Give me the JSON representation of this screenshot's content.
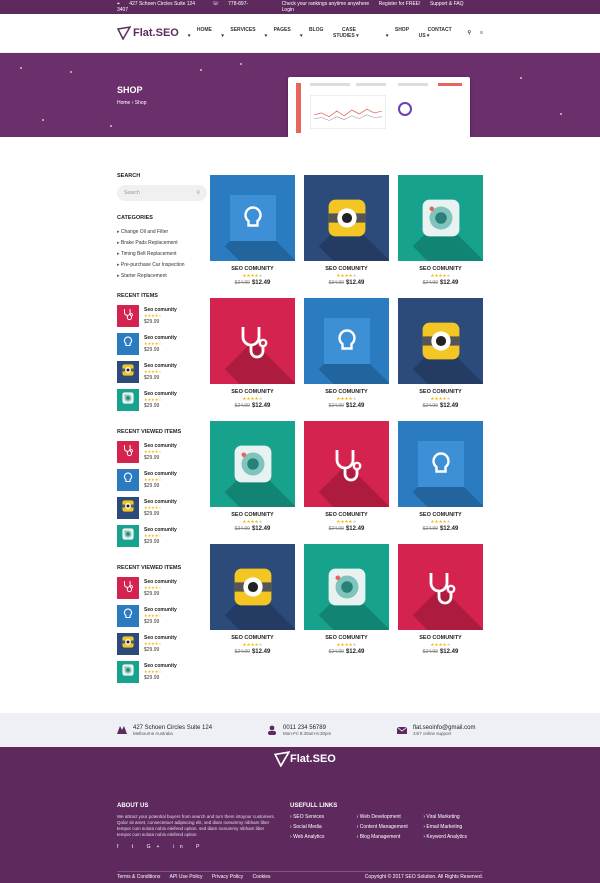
{
  "topbar": {
    "address": "427 Schoen Circles Suite 124",
    "phone": "778-897-3407",
    "links": [
      "Check your rankings anytime anywhere",
      "Register for FREE!",
      "Support & FAQ",
      "Login"
    ]
  },
  "nav": {
    "logo": "Flat.SEO",
    "menu": [
      "HOME",
      "SERVICES",
      "PAGES",
      "BLOG",
      "CASE STUDIES",
      "SHOP",
      "CONTACT US"
    ]
  },
  "hero": {
    "title": "SHOP",
    "breadcrumb": [
      "Home",
      "Shop"
    ]
  },
  "sidebar": {
    "search_title": "SEARCH",
    "search_placeholder": "Search",
    "categories_title": "CATEGORIES",
    "categories": [
      "Change Oil and Filter",
      "Brake Pads Replacement",
      "Timing Belt Replacement",
      "Pre-purchase Car Inspection",
      "Starter Replacement"
    ],
    "groups": [
      {
        "title": "RECENT ITEMS",
        "items": [
          {
            "name": "Seo comunity",
            "price": "$29.99",
            "color": "#d4234e",
            "icon": "stethoscope-icon"
          },
          {
            "name": "Seo comunity",
            "price": "$29.99",
            "color": "#2a7bc0",
            "icon": "bulb-icon"
          },
          {
            "name": "Seo comunity",
            "price": "$29.99",
            "color": "#2c4a7a",
            "icon": "eye-icon"
          },
          {
            "name": "Seo comunity",
            "price": "$29.99",
            "color": "#16a28d",
            "icon": "camera-icon"
          }
        ]
      },
      {
        "title": "RECENT VIEWED ITEMS",
        "items": [
          {
            "name": "Seo comunity",
            "price": "$29.99",
            "color": "#d4234e",
            "icon": "stethoscope-icon"
          },
          {
            "name": "Seo comunity",
            "price": "$29.99",
            "color": "#2a7bc0",
            "icon": "bulb-icon"
          },
          {
            "name": "Seo comunity",
            "price": "$29.99",
            "color": "#2c4a7a",
            "icon": "eye-icon"
          },
          {
            "name": "Seo comunity",
            "price": "$29.99",
            "color": "#16a28d",
            "icon": "camera-icon"
          }
        ]
      },
      {
        "title": "RECENT VIEWED ITEMS",
        "items": [
          {
            "name": "Seo comunity",
            "price": "$29.99",
            "color": "#d4234e",
            "icon": "stethoscope-icon"
          },
          {
            "name": "Seo comunity",
            "price": "$29.99",
            "color": "#2a7bc0",
            "icon": "bulb-icon"
          },
          {
            "name": "Seo comunity",
            "price": "$29.99",
            "color": "#2c4a7a",
            "icon": "eye-icon"
          },
          {
            "name": "Seo comunity",
            "price": "$29.99",
            "color": "#16a28d",
            "icon": "camera-icon"
          }
        ]
      }
    ]
  },
  "products": [
    {
      "title": "SEO COMUNITY",
      "old": "$24.99",
      "price": "$12.49",
      "bg": "#2a7bc0",
      "icon": "bulb-icon",
      "rating": 4
    },
    {
      "title": "SEO COMUNITY",
      "old": "$34.99",
      "price": "$12.49",
      "bg": "#2c4a7a",
      "icon": "eye-icon",
      "rating": 4
    },
    {
      "title": "SEO COMUNITY",
      "old": "$24.99",
      "price": "$12.49",
      "bg": "#16a28d",
      "icon": "camera-icon",
      "rating": 4
    },
    {
      "title": "SEO COMUNITY",
      "old": "$24.99",
      "price": "$12.49",
      "bg": "#d4234e",
      "icon": "stethoscope-icon",
      "rating": 4
    },
    {
      "title": "SEO COMUNITY",
      "old": "$24.99",
      "price": "$12.49",
      "bg": "#2a7bc0",
      "icon": "bulb-icon",
      "rating": 4
    },
    {
      "title": "SEO COMUNITY",
      "old": "$24.99",
      "price": "$12.49",
      "bg": "#2c4a7a",
      "icon": "eye-icon",
      "rating": 4
    },
    {
      "title": "SEO COMUNITY",
      "old": "$34.99",
      "price": "$12.49",
      "bg": "#16a28d",
      "icon": "camera-icon",
      "rating": 4
    },
    {
      "title": "SEO COMUNITY",
      "old": "$24.99",
      "price": "$12.49",
      "bg": "#d4234e",
      "icon": "stethoscope-icon",
      "rating": 4
    },
    {
      "title": "SEO COMUNITY",
      "old": "$24.99",
      "price": "$12.49",
      "bg": "#2a7bc0",
      "icon": "bulb-icon",
      "rating": 4
    },
    {
      "title": "SEO COMUNITY",
      "old": "$24.99",
      "price": "$12.49",
      "bg": "#2c4a7a",
      "icon": "eye-icon",
      "rating": 4
    },
    {
      "title": "SEO COMUNITY",
      "old": "$24.99",
      "price": "$12.49",
      "bg": "#16a28d",
      "icon": "camera-icon",
      "rating": 4
    },
    {
      "title": "SEO COMUNITY",
      "old": "$24.99",
      "price": "$12.49",
      "bg": "#d4234e",
      "icon": "stethoscope-icon",
      "rating": 4
    }
  ],
  "contact": [
    {
      "title": "427 Schoen Circles Suite 124",
      "sub": "Melbourne Australia",
      "icon": "map-icon"
    },
    {
      "title": "0011 234 56789",
      "sub": "Mon-Fri 8:30am-6:30pm",
      "icon": "user-icon"
    },
    {
      "title": "flat.seoinfo@gmail.com",
      "sub": "24/7 online support",
      "icon": "mail-icon"
    }
  ],
  "footer": {
    "logo": "Flat.SEO",
    "about_title": "ABOUT US",
    "about_text": "We attract your potential buyers from search and turn them intoyour customers. Qolor sit amet, consectetuer adipiscing elit, sed diam nonummy nibham liber tempor cum soluta nobis eleifend option. sed diam nonummy nibham liber tempor cum soluta nobis eleifend option",
    "social": [
      "f",
      "t",
      "G+",
      "in",
      "P"
    ],
    "links_title": "USEFULL LINKS",
    "links": [
      [
        "SEO Services",
        "Social Media",
        "Web Analytics"
      ],
      [
        "Web Development",
        "Content Management",
        "Blog Management"
      ],
      [
        "Viral Marketing",
        "Email Marketing",
        "Keyword Analytics"
      ]
    ],
    "bottom_links": [
      "Terms & Conditions",
      "API Use Policy",
      "Privacy Policy",
      "Cookies"
    ],
    "copyright": "Copyright © 2017 SEO Solution. All Rights Reserved."
  },
  "colors": {
    "purple": "#5e2a5e",
    "hero": "#6b2f6b",
    "star": "#f5b800"
  }
}
